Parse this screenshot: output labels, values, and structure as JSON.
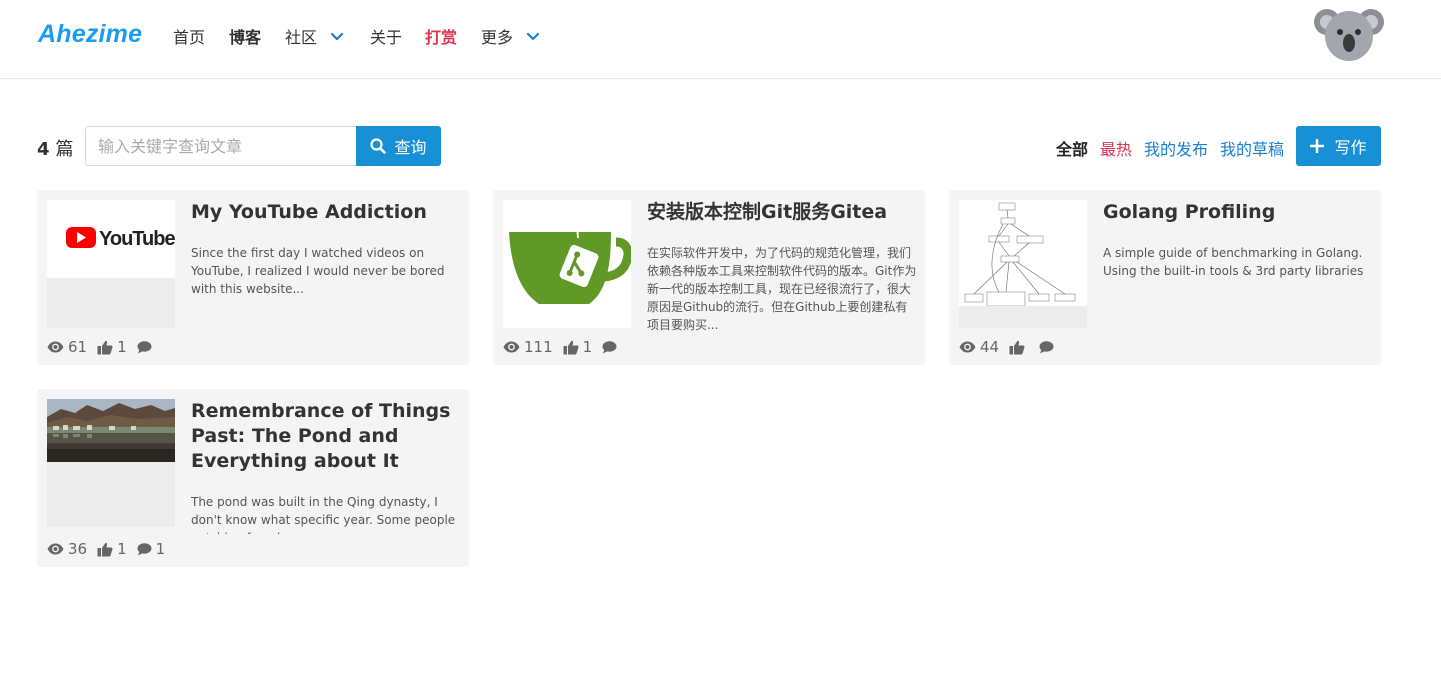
{
  "header": {
    "brand": "Ahezime",
    "nav": {
      "home": "首页",
      "blog": "博客",
      "community": "社区",
      "about": "关于",
      "reward": "打赏",
      "more": "更多"
    }
  },
  "toolbar": {
    "count_number": "4",
    "count_unit": "篇",
    "search_placeholder": "输入关键字查询文章",
    "search_button": "查询",
    "filters": {
      "all": "全部",
      "hot": "最热",
      "mine": "我的发布",
      "drafts": "我的草稿"
    },
    "write_button": "写作"
  },
  "colors": {
    "brand": "#1a9cf0",
    "primary": "#1890d5",
    "hot": "#e0334f",
    "link": "#1a7fd4"
  },
  "posts": [
    {
      "title": "My YouTube Addiction",
      "excerpt": "Since the first day I watched videos on YouTube, I realized I would never be bored with this website...",
      "thumbnail": "youtube-logo",
      "views": "61",
      "likes": "1",
      "comments": ""
    },
    {
      "title": "安装版本控制Git服务Gitea",
      "excerpt": "在实际软件开发中，为了代码的规范化管理，我们依赖各种版本工具来控制软件代码的版本。Git作为新一代的版本控制工具，现在已经很流行了，很大原因是Github的流行。但在Github上要创建私有项目要购买...",
      "thumbnail": "gitea-logo",
      "views": "111",
      "likes": "1",
      "comments": ""
    },
    {
      "title": "Golang Profiling",
      "excerpt": "A simple guide of benchmarking in Golang. Using the built-in tools & 3rd party libraries to profile ...",
      "thumbnail": "profiling-graph",
      "views": "44",
      "likes": "",
      "comments": ""
    },
    {
      "title": "Remembrance of Things Past: The Pond and Everything about It",
      "excerpt": "The pond was built in the Qing dynasty, I don't know what specific year. Some people outside of my h...",
      "thumbnail": "pond-landscape-photo",
      "views": "36",
      "likes": "1",
      "comments": "1"
    }
  ]
}
